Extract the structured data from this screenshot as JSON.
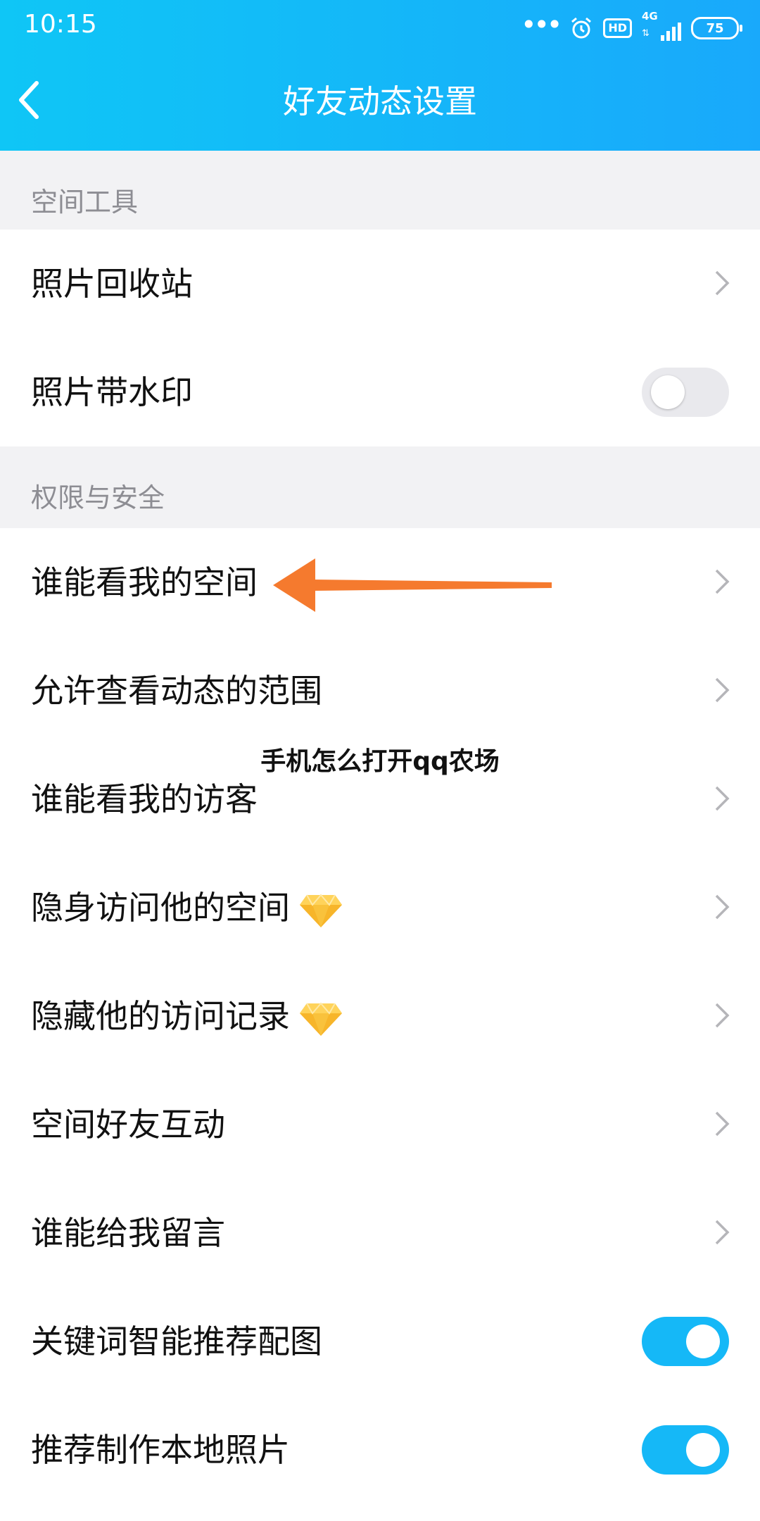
{
  "status_bar": {
    "time": "10:15",
    "network": "4G",
    "hd": "HD",
    "battery": "75"
  },
  "header": {
    "title": "好友动态设置"
  },
  "sections": [
    {
      "label": "空间工具",
      "items": [
        {
          "label": "照片回收站",
          "control": "chevron"
        },
        {
          "label": "照片带水印",
          "control": "toggle",
          "on": false
        }
      ]
    },
    {
      "label": "权限与安全",
      "items": [
        {
          "label": "谁能看我的空间",
          "control": "chevron"
        },
        {
          "label": "允许查看动态的范围",
          "control": "chevron"
        },
        {
          "label": "谁能看我的访客",
          "control": "chevron"
        },
        {
          "label": "隐身访问他的空间",
          "control": "chevron",
          "badge": "diamond-icon"
        },
        {
          "label": "隐藏他的访问记录",
          "control": "chevron",
          "badge": "diamond-icon"
        },
        {
          "label": "空间好友互动",
          "control": "chevron"
        },
        {
          "label": "谁能给我留言",
          "control": "chevron"
        },
        {
          "label": "关键词智能推荐配图",
          "control": "toggle",
          "on": true
        },
        {
          "label": "推荐制作本地照片",
          "control": "toggle",
          "on": true
        }
      ]
    }
  ],
  "overlay": {
    "watermark": "手机怎么打开qq农场",
    "arrow_color": "#f57a2e"
  },
  "colors": {
    "header_start": "#0fc6f6",
    "header_end": "#19a9fb",
    "toggle_on": "#15b8f7",
    "section_bg": "#f2f2f4"
  }
}
